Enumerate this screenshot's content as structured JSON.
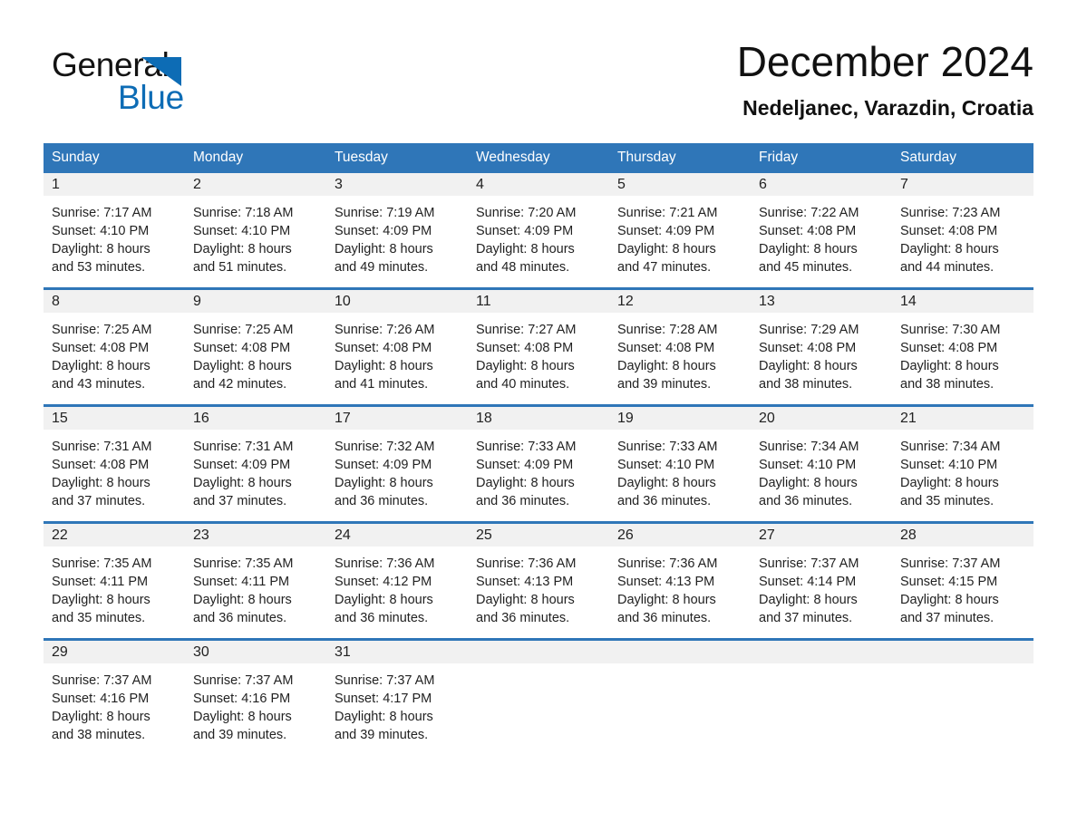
{
  "brand": {
    "name_part1": "General",
    "name_part2": "Blue",
    "triangle_color": "#0d6cb5",
    "text_color": "#131313"
  },
  "header": {
    "title": "December 2024",
    "location": "Nedeljanec, Varazdin, Croatia"
  },
  "theme": {
    "header_blue": "#2f76b8",
    "daynum_band": "#f1f1f1",
    "row_divider": "#2f76b8",
    "text": "#222222"
  },
  "calendar": {
    "weekday_headers": [
      "Sunday",
      "Monday",
      "Tuesday",
      "Wednesday",
      "Thursday",
      "Friday",
      "Saturday"
    ],
    "weeks": [
      [
        {
          "day": "1",
          "sunrise": "Sunrise: 7:17 AM",
          "sunset": "Sunset: 4:10 PM",
          "daylight_line1": "Daylight: 8 hours",
          "daylight_line2": "and 53 minutes."
        },
        {
          "day": "2",
          "sunrise": "Sunrise: 7:18 AM",
          "sunset": "Sunset: 4:10 PM",
          "daylight_line1": "Daylight: 8 hours",
          "daylight_line2": "and 51 minutes."
        },
        {
          "day": "3",
          "sunrise": "Sunrise: 7:19 AM",
          "sunset": "Sunset: 4:09 PM",
          "daylight_line1": "Daylight: 8 hours",
          "daylight_line2": "and 49 minutes."
        },
        {
          "day": "4",
          "sunrise": "Sunrise: 7:20 AM",
          "sunset": "Sunset: 4:09 PM",
          "daylight_line1": "Daylight: 8 hours",
          "daylight_line2": "and 48 minutes."
        },
        {
          "day": "5",
          "sunrise": "Sunrise: 7:21 AM",
          "sunset": "Sunset: 4:09 PM",
          "daylight_line1": "Daylight: 8 hours",
          "daylight_line2": "and 47 minutes."
        },
        {
          "day": "6",
          "sunrise": "Sunrise: 7:22 AM",
          "sunset": "Sunset: 4:08 PM",
          "daylight_line1": "Daylight: 8 hours",
          "daylight_line2": "and 45 minutes."
        },
        {
          "day": "7",
          "sunrise": "Sunrise: 7:23 AM",
          "sunset": "Sunset: 4:08 PM",
          "daylight_line1": "Daylight: 8 hours",
          "daylight_line2": "and 44 minutes."
        }
      ],
      [
        {
          "day": "8",
          "sunrise": "Sunrise: 7:25 AM",
          "sunset": "Sunset: 4:08 PM",
          "daylight_line1": "Daylight: 8 hours",
          "daylight_line2": "and 43 minutes."
        },
        {
          "day": "9",
          "sunrise": "Sunrise: 7:25 AM",
          "sunset": "Sunset: 4:08 PM",
          "daylight_line1": "Daylight: 8 hours",
          "daylight_line2": "and 42 minutes."
        },
        {
          "day": "10",
          "sunrise": "Sunrise: 7:26 AM",
          "sunset": "Sunset: 4:08 PM",
          "daylight_line1": "Daylight: 8 hours",
          "daylight_line2": "and 41 minutes."
        },
        {
          "day": "11",
          "sunrise": "Sunrise: 7:27 AM",
          "sunset": "Sunset: 4:08 PM",
          "daylight_line1": "Daylight: 8 hours",
          "daylight_line2": "and 40 minutes."
        },
        {
          "day": "12",
          "sunrise": "Sunrise: 7:28 AM",
          "sunset": "Sunset: 4:08 PM",
          "daylight_line1": "Daylight: 8 hours",
          "daylight_line2": "and 39 minutes."
        },
        {
          "day": "13",
          "sunrise": "Sunrise: 7:29 AM",
          "sunset": "Sunset: 4:08 PM",
          "daylight_line1": "Daylight: 8 hours",
          "daylight_line2": "and 38 minutes."
        },
        {
          "day": "14",
          "sunrise": "Sunrise: 7:30 AM",
          "sunset": "Sunset: 4:08 PM",
          "daylight_line1": "Daylight: 8 hours",
          "daylight_line2": "and 38 minutes."
        }
      ],
      [
        {
          "day": "15",
          "sunrise": "Sunrise: 7:31 AM",
          "sunset": "Sunset: 4:08 PM",
          "daylight_line1": "Daylight: 8 hours",
          "daylight_line2": "and 37 minutes."
        },
        {
          "day": "16",
          "sunrise": "Sunrise: 7:31 AM",
          "sunset": "Sunset: 4:09 PM",
          "daylight_line1": "Daylight: 8 hours",
          "daylight_line2": "and 37 minutes."
        },
        {
          "day": "17",
          "sunrise": "Sunrise: 7:32 AM",
          "sunset": "Sunset: 4:09 PM",
          "daylight_line1": "Daylight: 8 hours",
          "daylight_line2": "and 36 minutes."
        },
        {
          "day": "18",
          "sunrise": "Sunrise: 7:33 AM",
          "sunset": "Sunset: 4:09 PM",
          "daylight_line1": "Daylight: 8 hours",
          "daylight_line2": "and 36 minutes."
        },
        {
          "day": "19",
          "sunrise": "Sunrise: 7:33 AM",
          "sunset": "Sunset: 4:10 PM",
          "daylight_line1": "Daylight: 8 hours",
          "daylight_line2": "and 36 minutes."
        },
        {
          "day": "20",
          "sunrise": "Sunrise: 7:34 AM",
          "sunset": "Sunset: 4:10 PM",
          "daylight_line1": "Daylight: 8 hours",
          "daylight_line2": "and 36 minutes."
        },
        {
          "day": "21",
          "sunrise": "Sunrise: 7:34 AM",
          "sunset": "Sunset: 4:10 PM",
          "daylight_line1": "Daylight: 8 hours",
          "daylight_line2": "and 35 minutes."
        }
      ],
      [
        {
          "day": "22",
          "sunrise": "Sunrise: 7:35 AM",
          "sunset": "Sunset: 4:11 PM",
          "daylight_line1": "Daylight: 8 hours",
          "daylight_line2": "and 35 minutes."
        },
        {
          "day": "23",
          "sunrise": "Sunrise: 7:35 AM",
          "sunset": "Sunset: 4:11 PM",
          "daylight_line1": "Daylight: 8 hours",
          "daylight_line2": "and 36 minutes."
        },
        {
          "day": "24",
          "sunrise": "Sunrise: 7:36 AM",
          "sunset": "Sunset: 4:12 PM",
          "daylight_line1": "Daylight: 8 hours",
          "daylight_line2": "and 36 minutes."
        },
        {
          "day": "25",
          "sunrise": "Sunrise: 7:36 AM",
          "sunset": "Sunset: 4:13 PM",
          "daylight_line1": "Daylight: 8 hours",
          "daylight_line2": "and 36 minutes."
        },
        {
          "day": "26",
          "sunrise": "Sunrise: 7:36 AM",
          "sunset": "Sunset: 4:13 PM",
          "daylight_line1": "Daylight: 8 hours",
          "daylight_line2": "and 36 minutes."
        },
        {
          "day": "27",
          "sunrise": "Sunrise: 7:37 AM",
          "sunset": "Sunset: 4:14 PM",
          "daylight_line1": "Daylight: 8 hours",
          "daylight_line2": "and 37 minutes."
        },
        {
          "day": "28",
          "sunrise": "Sunrise: 7:37 AM",
          "sunset": "Sunset: 4:15 PM",
          "daylight_line1": "Daylight: 8 hours",
          "daylight_line2": "and 37 minutes."
        }
      ],
      [
        {
          "day": "29",
          "sunrise": "Sunrise: 7:37 AM",
          "sunset": "Sunset: 4:16 PM",
          "daylight_line1": "Daylight: 8 hours",
          "daylight_line2": "and 38 minutes."
        },
        {
          "day": "30",
          "sunrise": "Sunrise: 7:37 AM",
          "sunset": "Sunset: 4:16 PM",
          "daylight_line1": "Daylight: 8 hours",
          "daylight_line2": "and 39 minutes."
        },
        {
          "day": "31",
          "sunrise": "Sunrise: 7:37 AM",
          "sunset": "Sunset: 4:17 PM",
          "daylight_line1": "Daylight: 8 hours",
          "daylight_line2": "and 39 minutes."
        },
        {
          "day": "",
          "sunrise": "",
          "sunset": "",
          "daylight_line1": "",
          "daylight_line2": ""
        },
        {
          "day": "",
          "sunrise": "",
          "sunset": "",
          "daylight_line1": "",
          "daylight_line2": ""
        },
        {
          "day": "",
          "sunrise": "",
          "sunset": "",
          "daylight_line1": "",
          "daylight_line2": ""
        },
        {
          "day": "",
          "sunrise": "",
          "sunset": "",
          "daylight_line1": "",
          "daylight_line2": ""
        }
      ]
    ]
  }
}
